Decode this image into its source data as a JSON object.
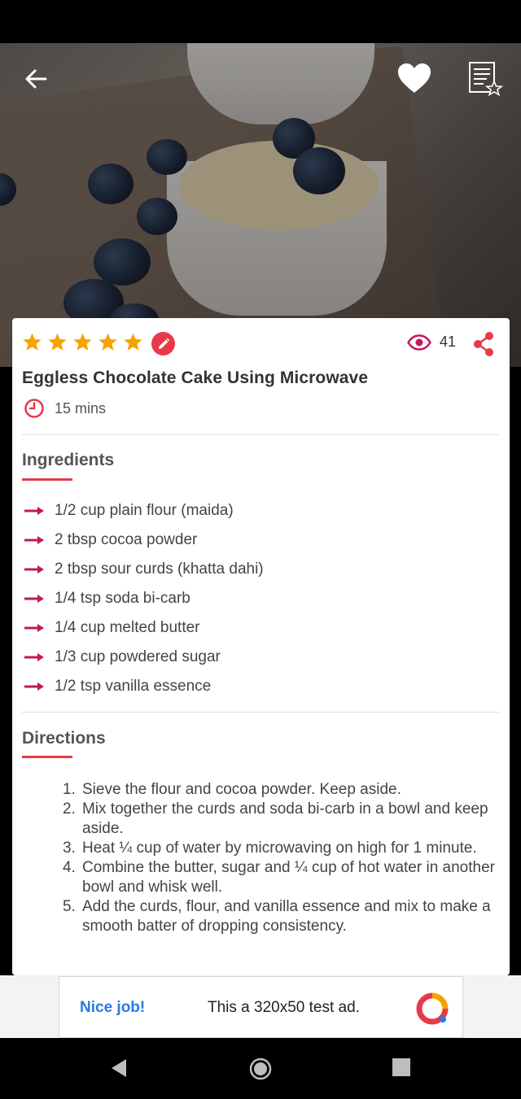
{
  "header": {
    "back_icon": "arrow-left-icon",
    "favorite_icon": "heart-icon",
    "list_icon": "recipe-list-star-icon"
  },
  "recipe": {
    "rating_stars": 5,
    "views": "41",
    "title": "Eggless Chocolate Cake Using Microwave",
    "time": "15 mins"
  },
  "ingredients": {
    "heading": "Ingredients",
    "items": [
      "1/2 cup plain flour (maida)",
      "2 tbsp cocoa powder",
      "2 tbsp sour curds (khatta dahi)",
      "1/4 tsp soda bi-carb",
      "1/4 cup melted butter",
      "1/3 cup powdered sugar",
      "1/2 tsp vanilla essence"
    ]
  },
  "directions": {
    "heading": "Directions",
    "steps": [
      {
        "num": "1.",
        "text": "Sieve the flour and cocoa powder. Keep aside."
      },
      {
        "num": "2.",
        "text": "Mix together the curds and soda bi-carb in a bowl and keep aside."
      },
      {
        "num": "3.",
        "text": "Heat ¼ cup of water by microwaving on high for 1 minute."
      },
      {
        "num": "4.",
        "text": "Combine the butter, sugar and ¼ cup of hot water in another bowl and whisk well."
      },
      {
        "num": "5.",
        "text": "Add the curds, flour, and vanilla essence and mix to make a smooth batter of dropping consistency."
      }
    ]
  },
  "ad": {
    "label": "Nice job!",
    "text": "This a 320x50 test ad."
  },
  "colors": {
    "accent": "#e8394a",
    "star": "#f5a300",
    "view_icon": "#c2185b"
  }
}
